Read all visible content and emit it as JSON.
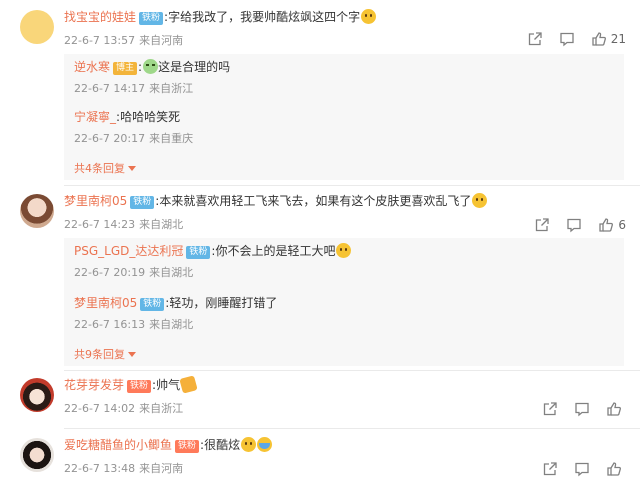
{
  "comments": [
    {
      "name": "找宝宝的娃娃",
      "badge": "铁粉",
      "text": "字给我改了，我要帅酷炫飒这四个字",
      "date": "22-6-7 13:57",
      "location": "来自河南",
      "like_count": "21",
      "replies": [
        {
          "name": "逆水寒",
          "badge": "博主",
          "text": "这是合理的吗",
          "date": "22-6-7 14:17",
          "location": "来自浙江"
        },
        {
          "name": "宁凝寧_",
          "text": "哈哈哈笑死",
          "date": "22-6-7 20:17",
          "location": "来自重庆"
        }
      ],
      "more": "共4条回复"
    },
    {
      "name": "梦里南柯05",
      "badge": "铁粉",
      "text": "本来就喜欢用轻工飞来飞去，如果有这个皮肤更喜欢乱飞了",
      "date": "22-6-7 14:23",
      "location": "来自湖北",
      "like_count": "6",
      "replies": [
        {
          "name": "PSG_LGD_达达利冠",
          "badge": "铁粉",
          "text": "你不会上的是轻工大吧",
          "date": "22-6-7 20:19",
          "location": "来自湖北"
        },
        {
          "name": "梦里南柯05",
          "badge": "铁粉",
          "text": "轻功，刚睡醒打错了",
          "date": "22-6-7 16:13",
          "location": "来自湖北"
        }
      ],
      "more": "共9条回复"
    },
    {
      "name": "花芽芽发芽",
      "badge": "铁粉",
      "text": "帅气",
      "date": "22-6-7 14:02",
      "location": "来自浙江",
      "like_count": ""
    },
    {
      "name": "爱吃糖醋鱼的小鲫鱼",
      "badge": "铁粉",
      "text": "很酷炫",
      "date": "22-6-7 13:48",
      "location": "来自河南",
      "like_count": ""
    }
  ],
  "icons": {
    "share": "share-icon",
    "comment": "comment-icon",
    "like": "like-icon"
  },
  "colors": {
    "name": "#eb7350",
    "badge_fan": "#62b6e6",
    "badge_owner": "#f3b43a",
    "reply_bg": "#f7f7f7",
    "meta": "#939393"
  }
}
